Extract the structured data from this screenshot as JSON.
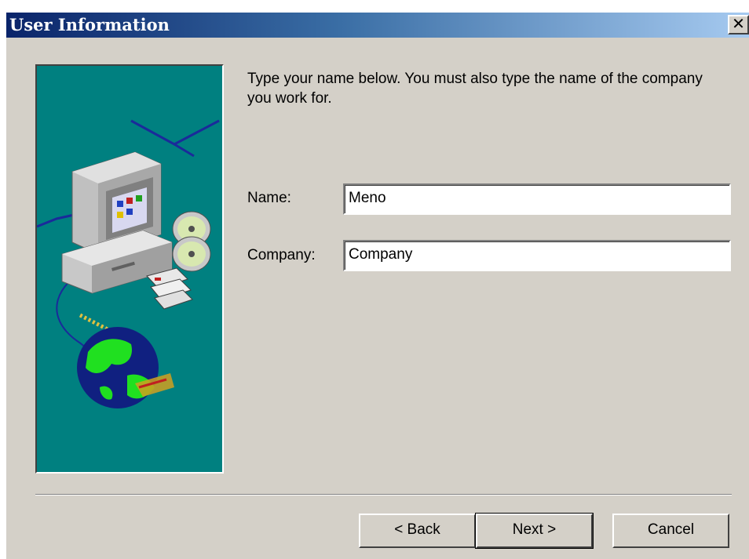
{
  "window": {
    "title": "User Information",
    "close_glyph": "✕"
  },
  "instructions": "Type your name below. You must also type the name of the company you work for.",
  "form": {
    "name_label": "Name:",
    "name_value": "Meno",
    "company_label": "Company:",
    "company_value": "Company"
  },
  "buttons": {
    "back": "< Back",
    "next": "Next >",
    "cancel": "Cancel"
  },
  "illustration": {
    "icons": [
      "computer-icon",
      "cd-icon",
      "floppy-disk-icon",
      "globe-icon"
    ]
  },
  "colors": {
    "title_start": "#0a246a",
    "title_end": "#a6caf0",
    "dialog_bg": "#d4d0c8",
    "art_bg": "#008080"
  }
}
